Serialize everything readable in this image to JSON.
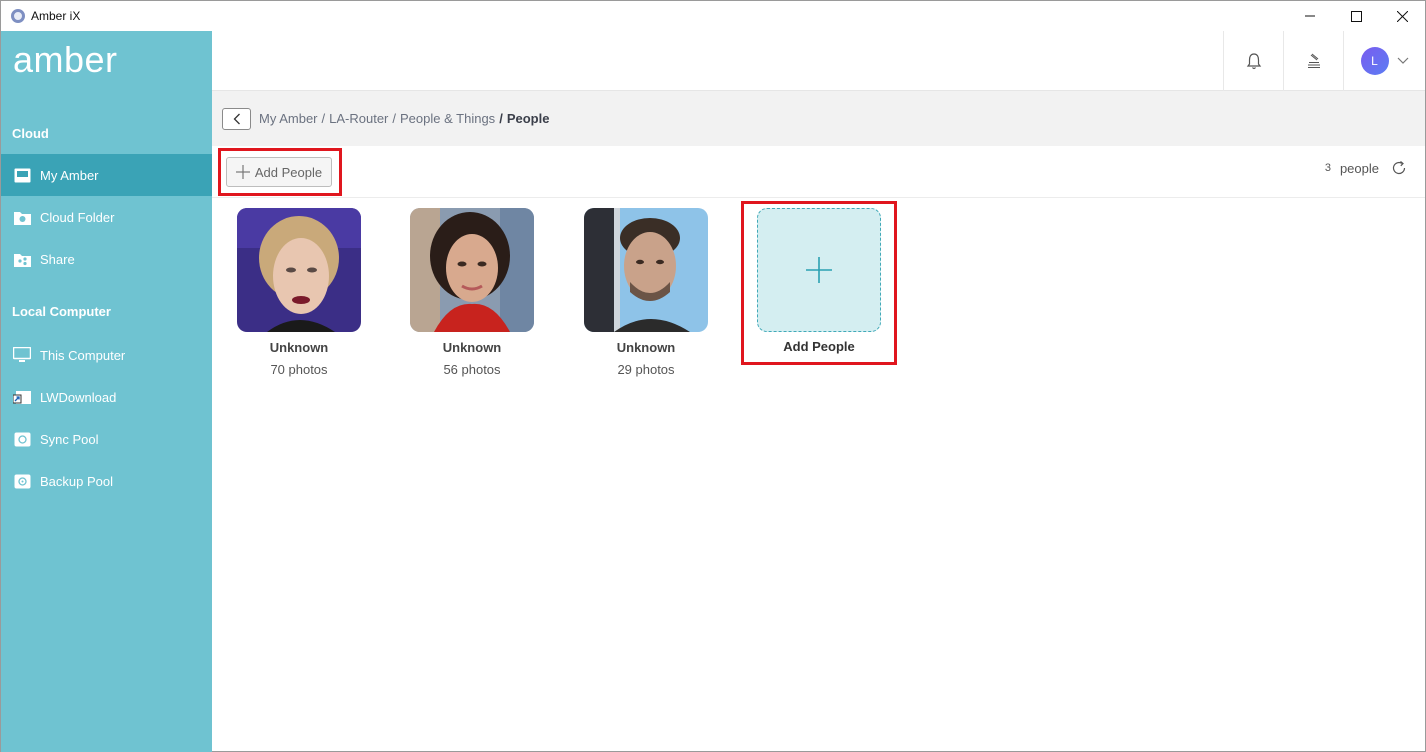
{
  "window": {
    "title": "Amber iX"
  },
  "sidebar": {
    "logo": "amber",
    "cloud_label": "Cloud",
    "local_label": "Local Computer",
    "cloud_items": [
      {
        "label": "My Amber",
        "icon": "drive-icon"
      },
      {
        "label": "Cloud Folder",
        "icon": "cloud-folder-icon"
      },
      {
        "label": "Share",
        "icon": "share-icon"
      }
    ],
    "local_items": [
      {
        "label": "This Computer",
        "icon": "monitor-icon"
      },
      {
        "label": "LWDownload",
        "icon": "shortcut-folder-icon"
      },
      {
        "label": "Sync Pool",
        "icon": "sync-pool-icon"
      },
      {
        "label": "Backup Pool",
        "icon": "backup-pool-icon"
      }
    ]
  },
  "header": {
    "avatar_initial": "L"
  },
  "breadcrumb": {
    "items": [
      "My Amber",
      "LA-Router",
      "People & Things"
    ],
    "current": "People",
    "separator": "/"
  },
  "toolbar": {
    "add_label": "Add People",
    "count_num": "3",
    "count_unit": "people"
  },
  "people": [
    {
      "name": "Unknown",
      "photos": "70 photos"
    },
    {
      "name": "Unknown",
      "photos": "56 photos"
    },
    {
      "name": "Unknown",
      "photos": "29 photos"
    }
  ],
  "add_card": {
    "label": "Add People"
  },
  "colors": {
    "sidebar": "#6fc3d1",
    "sidebar_active": "#3aa3b6",
    "highlight": "#e0161e",
    "add_card_bg": "#d4eef1"
  }
}
